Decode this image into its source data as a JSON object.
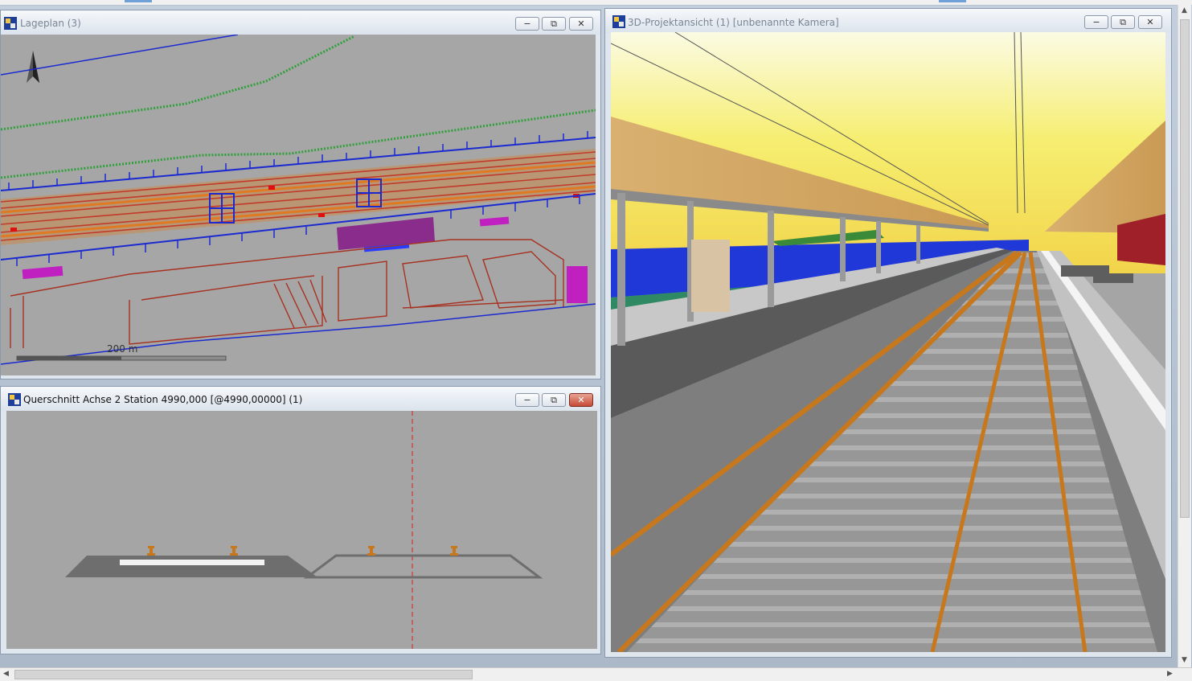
{
  "windows": {
    "lageplan": {
      "title": "Lageplan (3)",
      "scale_label": "200 m"
    },
    "querschnitt": {
      "title": "Querschnitt Achse 2 Station 4990,000 [@4990,00000] (1)"
    },
    "view3d": {
      "title": "3D-Projektansicht (1) [unbenannte Kamera]"
    }
  },
  "controls": {
    "minimize": "−",
    "restore": "⧉",
    "close": "✕"
  },
  "colors": {
    "plan_bg": "#a6a6a6",
    "track_red": "#c23a2a",
    "track_orange": "#e07a22",
    "embankment_green": "#2fa03a",
    "mast_blue": "#1a2ad0",
    "building_magenta": "#c020c0",
    "rail_orange": "#c8781c",
    "sky_yellow": "#f6f07a"
  }
}
